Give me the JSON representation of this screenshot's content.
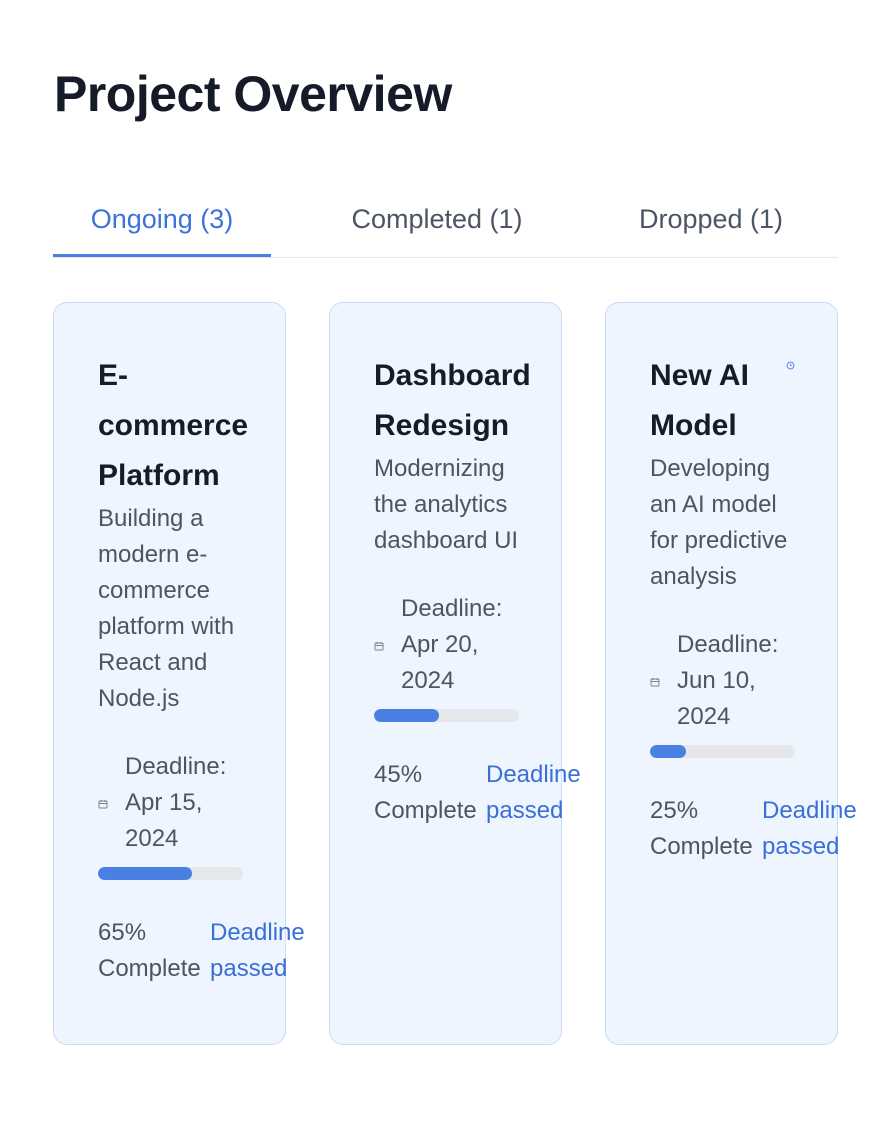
{
  "page": {
    "title": "Project Overview"
  },
  "tabs": [
    {
      "label": "Ongoing (3)",
      "active": true
    },
    {
      "label": "Completed (1)",
      "active": false
    },
    {
      "label": "Dropped (1)",
      "active": false
    }
  ],
  "projects": [
    {
      "title": "E-commerce Platform",
      "description": "Building a modern e-commerce platform with React and Node.js",
      "deadline_label": "Deadline:",
      "deadline_date": "Apr 15, 2024",
      "progress": 0.65,
      "progress_text": "65% Complete",
      "status_text": "Deadline passed",
      "icon": "calendar-icon"
    },
    {
      "title": "Dashboard Redesign",
      "description": "Modernizing the analytics dashboard UI",
      "deadline_label": "Deadline:",
      "deadline_date": "Apr 20, 2024",
      "progress": 0.45,
      "progress_text": "45% Complete",
      "status_text": "Deadline passed",
      "icon": "calendar-icon"
    },
    {
      "title": "New AI Model",
      "description": "Developing an AI model for predictive analysis",
      "deadline_label": "Deadline:",
      "deadline_date": "Jun 10, 2024",
      "progress": 0.25,
      "progress_text": "25% Complete",
      "status_text": "Deadline passed",
      "icon": "calendar-icon",
      "badge_icon": "clock-icon"
    }
  ],
  "colors": {
    "accent": "#4a7fe3",
    "card_bg": "#eef5fe",
    "card_border": "#c9dcf5",
    "title": "#151b28",
    "body_text": "#4b5563",
    "track": "#e5e7eb"
  }
}
